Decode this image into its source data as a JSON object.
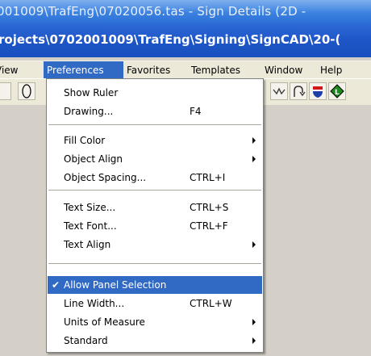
{
  "window": {
    "title_background": "001009\\TrafEng\\07020056.tas - Sign Details (2D -",
    "title_active": "rojects\\0702001009\\TrafEng\\Signing\\SignCAD\\20-("
  },
  "menubar": {
    "items": [
      {
        "label": "View"
      },
      {
        "label": "Preferences"
      },
      {
        "label": "Favorites"
      },
      {
        "label": "Templates"
      },
      {
        "label": "Window"
      },
      {
        "label": "Help"
      }
    ],
    "active": "Preferences"
  },
  "preferences_menu": {
    "items": [
      {
        "label": "Show Ruler",
        "shortcut": ""
      },
      {
        "label": "Drawing...",
        "shortcut": "F4"
      },
      {
        "label": "Fill Color",
        "shortcut": "",
        "submenu": true
      },
      {
        "label": "Object Align",
        "shortcut": "",
        "submenu": true
      },
      {
        "label": "Object Spacing...",
        "shortcut": "CTRL+I"
      },
      {
        "label": "Text Size...",
        "shortcut": "CTRL+S"
      },
      {
        "label": "Text Font...",
        "shortcut": "CTRL+F"
      },
      {
        "label": "Text Align",
        "shortcut": "",
        "submenu": true
      },
      {
        "label": "Allow Panel Selection",
        "shortcut": "",
        "checked": true,
        "highlighted": true
      },
      {
        "label": "Line Width...",
        "shortcut": "CTRL+W"
      },
      {
        "label": "Units of Measure",
        "shortcut": "",
        "submenu": true
      },
      {
        "label": "Standard",
        "shortcut": "",
        "submenu": true
      }
    ]
  },
  "colors": {
    "highlight": "#316ac5",
    "menu_bg": "#ece9d8",
    "title_active": "#1e56c8"
  }
}
